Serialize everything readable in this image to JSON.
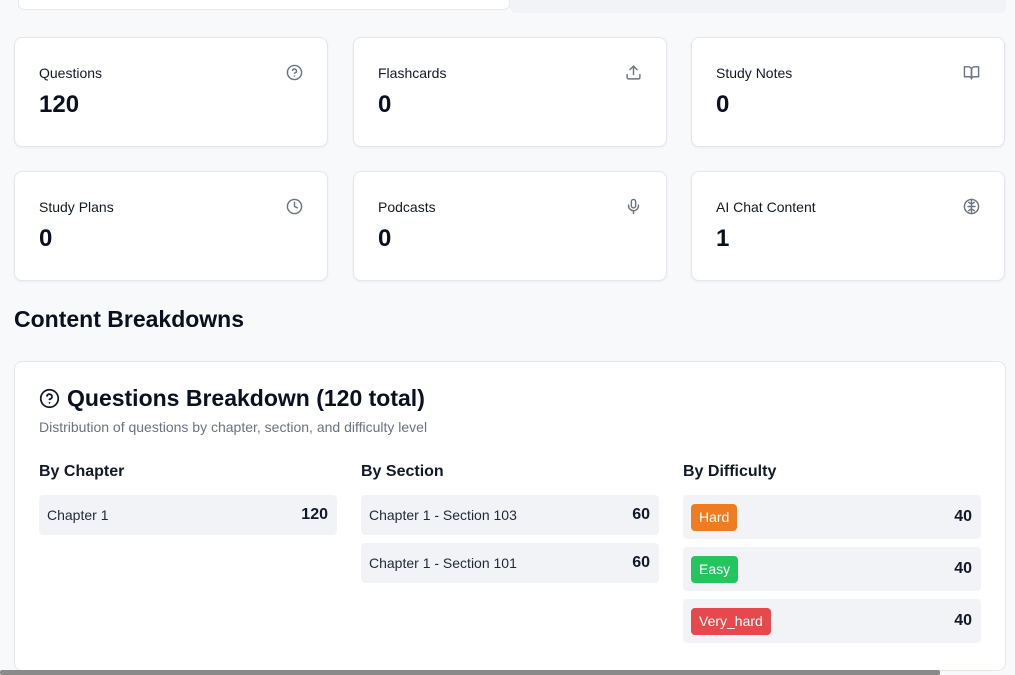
{
  "stats": [
    {
      "title": "Questions",
      "value": "120",
      "icon": "question-circle-icon"
    },
    {
      "title": "Flashcards",
      "value": "0",
      "icon": "upload-icon"
    },
    {
      "title": "Study Notes",
      "value": "0",
      "icon": "book-open-icon"
    },
    {
      "title": "Study Plans",
      "value": "0",
      "icon": "clock-icon"
    },
    {
      "title": "Podcasts",
      "value": "0",
      "icon": "microphone-icon"
    },
    {
      "title": "AI Chat Content",
      "value": "1",
      "icon": "brain-icon"
    }
  ],
  "content_breakdowns": {
    "heading": "Content Breakdowns",
    "questions": {
      "title": "Questions Breakdown (120 total)",
      "subtitle": "Distribution of questions by chapter, section, and difficulty level",
      "by_chapter": {
        "heading": "By Chapter",
        "rows": [
          {
            "label": "Chapter 1",
            "count": "120"
          }
        ]
      },
      "by_section": {
        "heading": "By Section",
        "rows": [
          {
            "label": "Chapter 1 - Section 103",
            "count": "60"
          },
          {
            "label": "Chapter 1 - Section 101",
            "count": "60"
          }
        ]
      },
      "by_difficulty": {
        "heading": "By Difficulty",
        "rows": [
          {
            "label": "Hard",
            "count": "40",
            "color": "#f07c22"
          },
          {
            "label": "Easy",
            "count": "40",
            "color": "#22c55e"
          },
          {
            "label": "Very_hard",
            "count": "40",
            "color": "#e5484d"
          }
        ]
      }
    }
  }
}
